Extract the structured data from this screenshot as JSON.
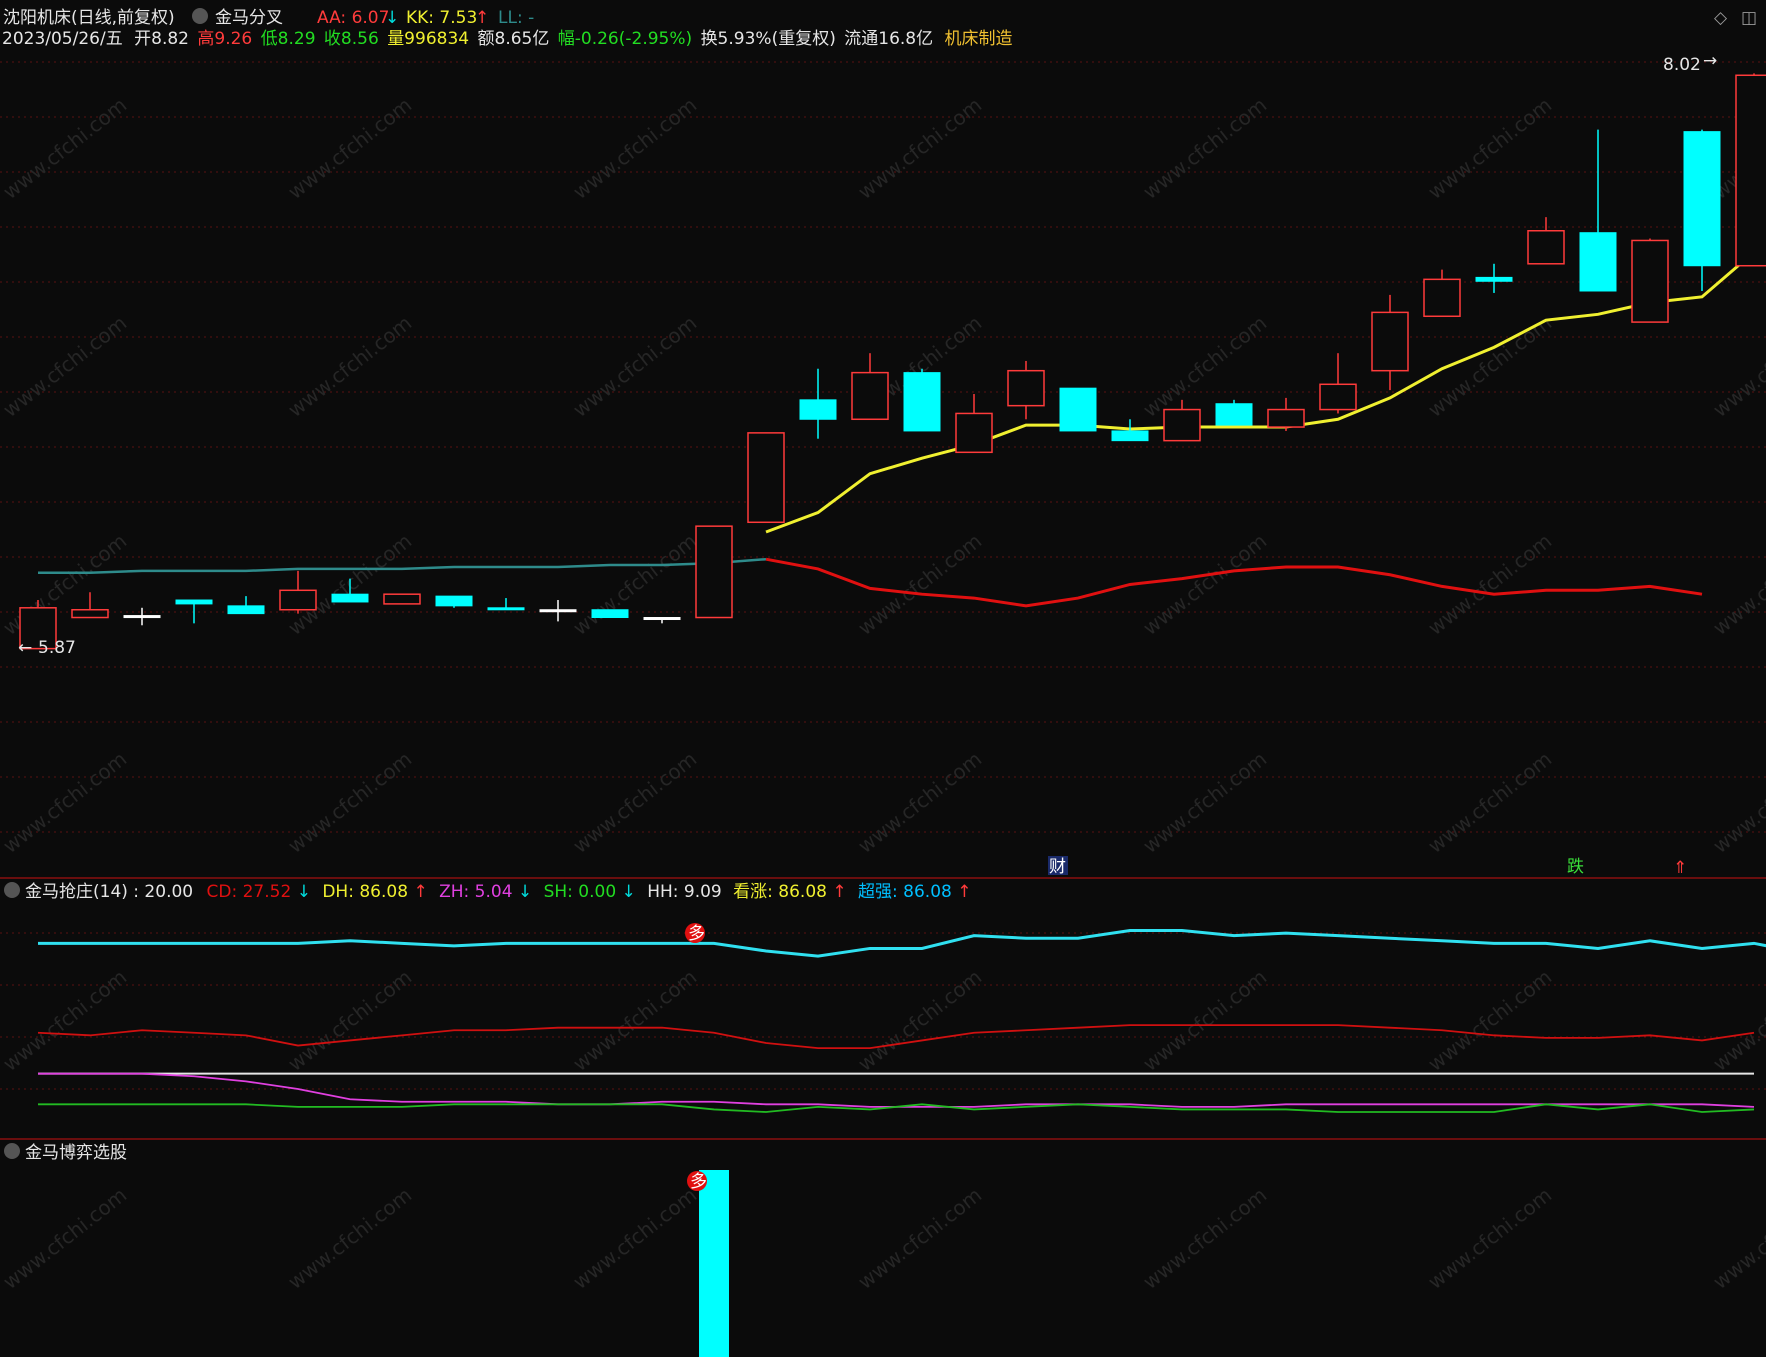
{
  "header": {
    "stock_name": "沈阳机床(日线,前复权)",
    "indicator_name": "金马分叉",
    "aa_label": "AA: 6.07",
    "kk_label": "KK: 7.53",
    "ll_label": "LL: -",
    "date": "2023/05/26/五",
    "open": "开8.82",
    "high": "高9.26",
    "low": "低8.29",
    "close": "收8.56",
    "volume": "量996834",
    "amount": "额8.65亿",
    "change": "幅-0.26(-2.95%)",
    "turnover": "换5.93%(重复权)",
    "float_cap": "流通16.8亿",
    "sector": "机床制造"
  },
  "colors": {
    "up": "#ff3b3b",
    "down": "#00ffff",
    "ma_yellow": "#f0f030",
    "line_teal": "#2e8b8b",
    "line_red": "#e01010",
    "grid": "#5a1010"
  },
  "markers": {
    "cai": "财",
    "die": "跌",
    "duo": "多",
    "max_label": "8.02",
    "min_label": "5.87"
  },
  "panel2": {
    "title": "金马抢庄(14) : 20.00",
    "cd": "CD: 27.52",
    "dh": "DH: 86.08",
    "zh": "ZH: 5.04",
    "sh": "SH: 0.00",
    "hh": "HH: 9.09",
    "kanzhang": "看涨: 86.08",
    "chaoqiang": "超强: 86.08"
  },
  "panel3": {
    "title": "金马博弈选股"
  },
  "watermark": "www.cfchi.com",
  "chart_data": {
    "type": "candlestick",
    "candles": [
      {
        "o": 5.87,
        "c": 6.08,
        "h": 6.12,
        "l": 5.87
      },
      {
        "o": 6.03,
        "c": 6.07,
        "h": 6.16,
        "l": 6.03
      },
      {
        "o": 6.04,
        "c": 6.04,
        "h": 6.08,
        "l": 5.99
      },
      {
        "o": 6.12,
        "c": 6.1,
        "h": 6.12,
        "l": 6.0
      },
      {
        "o": 6.09,
        "c": 6.05,
        "h": 6.14,
        "l": 6.05
      },
      {
        "o": 6.07,
        "c": 6.17,
        "h": 6.27,
        "l": 6.05
      },
      {
        "o": 6.15,
        "c": 6.11,
        "h": 6.23,
        "l": 6.11
      },
      {
        "o": 6.1,
        "c": 6.15,
        "h": 6.15,
        "l": 6.1
      },
      {
        "o": 6.14,
        "c": 6.09,
        "h": 6.14,
        "l": 6.08
      },
      {
        "o": 6.08,
        "c": 6.07,
        "h": 6.13,
        "l": 6.07
      },
      {
        "o": 6.07,
        "c": 6.07,
        "h": 6.12,
        "l": 6.01
      },
      {
        "o": 6.07,
        "c": 6.03,
        "h": 6.07,
        "l": 6.03
      },
      {
        "o": 6.03,
        "c": 6.03,
        "h": 6.03,
        "l": 6.0
      },
      {
        "o": 6.03,
        "c": 6.5,
        "h": 6.5,
        "l": 6.03
      },
      {
        "o": 6.52,
        "c": 6.98,
        "h": 6.98,
        "l": 6.52
      },
      {
        "o": 7.15,
        "c": 7.05,
        "h": 7.31,
        "l": 6.95
      },
      {
        "o": 7.05,
        "c": 7.29,
        "h": 7.39,
        "l": 7.05
      },
      {
        "o": 7.29,
        "c": 6.99,
        "h": 7.31,
        "l": 6.99
      },
      {
        "o": 6.88,
        "c": 7.08,
        "h": 7.18,
        "l": 6.88
      },
      {
        "o": 7.12,
        "c": 7.3,
        "h": 7.35,
        "l": 7.05
      },
      {
        "o": 7.21,
        "c": 6.99,
        "h": 7.21,
        "l": 6.99
      },
      {
        "o": 6.99,
        "c": 6.94,
        "h": 7.05,
        "l": 6.94
      },
      {
        "o": 6.94,
        "c": 7.1,
        "h": 7.15,
        "l": 6.94
      },
      {
        "o": 7.13,
        "c": 7.02,
        "h": 7.15,
        "l": 7.02
      },
      {
        "o": 7.01,
        "c": 7.1,
        "h": 7.16,
        "l": 6.99
      },
      {
        "o": 7.1,
        "c": 7.23,
        "h": 7.39,
        "l": 7.08
      },
      {
        "o": 7.3,
        "c": 7.6,
        "h": 7.69,
        "l": 7.2
      },
      {
        "o": 7.58,
        "c": 7.77,
        "h": 7.82,
        "l": 7.58
      },
      {
        "o": 7.78,
        "c": 7.76,
        "h": 7.85,
        "l": 7.7
      },
      {
        "o": 7.85,
        "c": 8.02,
        "h": 8.09,
        "l": 7.85
      },
      {
        "o": 8.01,
        "c": 7.71,
        "h": 8.54,
        "l": 7.71
      },
      {
        "o": 7.55,
        "c": 7.97,
        "h": 7.98,
        "l": 7.55
      },
      {
        "o": 8.53,
        "c": 7.84,
        "h": 8.54,
        "l": 7.71
      },
      {
        "o": 7.84,
        "c": 8.82,
        "h": 8.83,
        "l": 7.84
      }
    ],
    "ma_yellow": [
      null,
      null,
      null,
      null,
      null,
      null,
      null,
      null,
      null,
      null,
      null,
      null,
      null,
      null,
      6.47,
      6.57,
      6.77,
      6.85,
      6.92,
      7.02,
      7.02,
      7.0,
      7.01,
      7.01,
      7.01,
      7.05,
      7.16,
      7.31,
      7.42,
      7.56,
      7.59,
      7.65,
      7.68,
      7.91
    ],
    "line_teal": [
      6.26,
      6.26,
      6.27,
      6.27,
      6.27,
      6.28,
      6.28,
      6.28,
      6.29,
      6.29,
      6.29,
      6.3,
      6.3,
      6.31,
      6.33
    ],
    "line_red": [
      null,
      null,
      null,
      null,
      null,
      null,
      null,
      null,
      null,
      null,
      null,
      null,
      null,
      null,
      6.33,
      6.28,
      6.18,
      6.15,
      6.13,
      6.09,
      6.13,
      6.2,
      6.23,
      6.27,
      6.29,
      6.29,
      6.25,
      6.19,
      6.15,
      6.17,
      6.17,
      6.19,
      6.15
    ],
    "ylim": [
      4.7,
      8.95
    ],
    "panel2": {
      "cyan": [
        15,
        15,
        15,
        15,
        15,
        15,
        14,
        15,
        16,
        15,
        15,
        15,
        15,
        15,
        18,
        20,
        17,
        17,
        12,
        13,
        13,
        10,
        10,
        12,
        11,
        12,
        13,
        14,
        15,
        15,
        17,
        14,
        17,
        15,
        19
      ],
      "red": [
        50,
        51,
        49,
        50,
        51,
        55,
        53,
        51,
        49,
        49,
        48,
        48,
        48,
        50,
        54,
        56,
        56,
        53,
        50,
        49,
        48,
        47,
        47,
        47,
        47,
        47,
        48,
        49,
        51,
        52,
        52,
        51,
        53,
        50
      ],
      "white": [
        66,
        66,
        66,
        66,
        66,
        66,
        66,
        66,
        66,
        66,
        66,
        66,
        66,
        66,
        66,
        66,
        66,
        66,
        66,
        66,
        66,
        66,
        66,
        66,
        66,
        66,
        66,
        66,
        66,
        66,
        66,
        66,
        66,
        66
      ],
      "magenta": [
        66,
        66,
        66,
        67,
        69,
        72,
        76,
        77,
        77,
        77,
        78,
        78,
        77,
        77,
        78,
        78,
        79,
        79,
        79,
        78,
        78,
        78,
        79,
        79,
        78,
        78,
        78,
        78,
        78,
        78,
        78,
        78,
        78,
        79
      ],
      "green": [
        78,
        78,
        78,
        78,
        78,
        79,
        79,
        79,
        78,
        78,
        78,
        78,
        78,
        80,
        81,
        79,
        80,
        78,
        80,
        79,
        78,
        79,
        80,
        80,
        80,
        81,
        81,
        81,
        81,
        78,
        80,
        78,
        81,
        80
      ],
      "ylim": [
        0,
        90
      ]
    },
    "panel3": {
      "bars": [
        0,
        0,
        0,
        0,
        0,
        0,
        0,
        0,
        0,
        0,
        0,
        0,
        0,
        100,
        0,
        0,
        0,
        0,
        0,
        0,
        0,
        0,
        0,
        0,
        0,
        0,
        0,
        0,
        0,
        0,
        0,
        0,
        0,
        0
      ],
      "ylim": [
        0,
        100
      ]
    }
  }
}
